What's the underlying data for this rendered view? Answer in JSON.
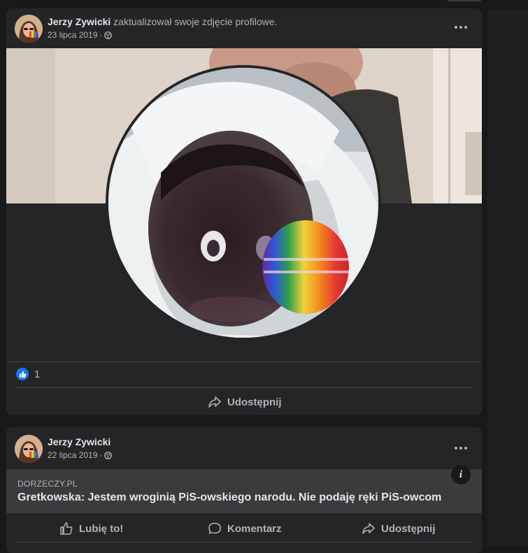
{
  "post1": {
    "author": "Jerzy Zywicki",
    "action_text": "zaktualizował swoje zdjęcie profilowe.",
    "date": "23 lipca 2019",
    "separator": "·",
    "privacy_icon": "globe-icon",
    "reaction_icon": "like-icon",
    "reaction_count": "1",
    "share_label": "Udostępnij"
  },
  "post2": {
    "author": "Jerzy Zywicki",
    "date": "22 lipca 2019",
    "separator": "·",
    "privacy_icon": "globe-icon",
    "link": {
      "domain": "DORZECZY.PL",
      "title": "Gretkowska: Jestem wroginią PiS-owskiego narodu. Nie podaję ręki PiS-owcom"
    },
    "info_label": "i",
    "like_label": "Lubię to!",
    "comment_label": "Komentarz",
    "share_label": "Udostępnij"
  },
  "colors": {
    "background": "#18191a",
    "card": "#242526",
    "text_primary": "#e4e6eb",
    "text_secondary": "#b0b3b8",
    "like_blue": "#1877f2"
  }
}
